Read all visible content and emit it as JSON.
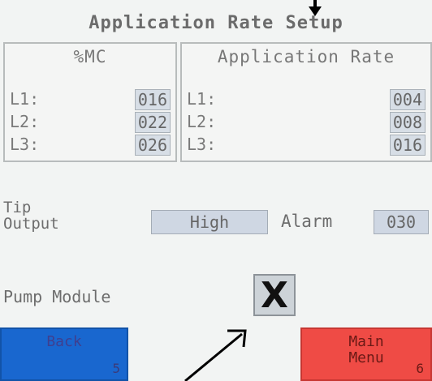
{
  "title": "Application Rate Setup",
  "mc_panel": {
    "header": "%MC",
    "rows": [
      {
        "label": "L1:",
        "value": "016"
      },
      {
        "label": "L2:",
        "value": "022"
      },
      {
        "label": "L3:",
        "value": "026"
      }
    ]
  },
  "rate_panel": {
    "header": "Application Rate",
    "rows": [
      {
        "label": "L1:",
        "value": "004"
      },
      {
        "label": "L2:",
        "value": "008"
      },
      {
        "label": "L3:",
        "value": "016"
      }
    ]
  },
  "tip_output": {
    "label": "Tip\nOutput",
    "value": "High"
  },
  "alarm": {
    "label": "Alarm",
    "value": "030"
  },
  "pump_module": {
    "label": "Pump Module",
    "toggle_glyph": "X"
  },
  "buttons": {
    "back": {
      "label": "Back",
      "key": "5"
    },
    "main_menu": {
      "label": "Main\nMenu",
      "key": "6"
    }
  },
  "colors": {
    "back_button": "#1967cf",
    "main_menu_button": "#ef4b45"
  }
}
